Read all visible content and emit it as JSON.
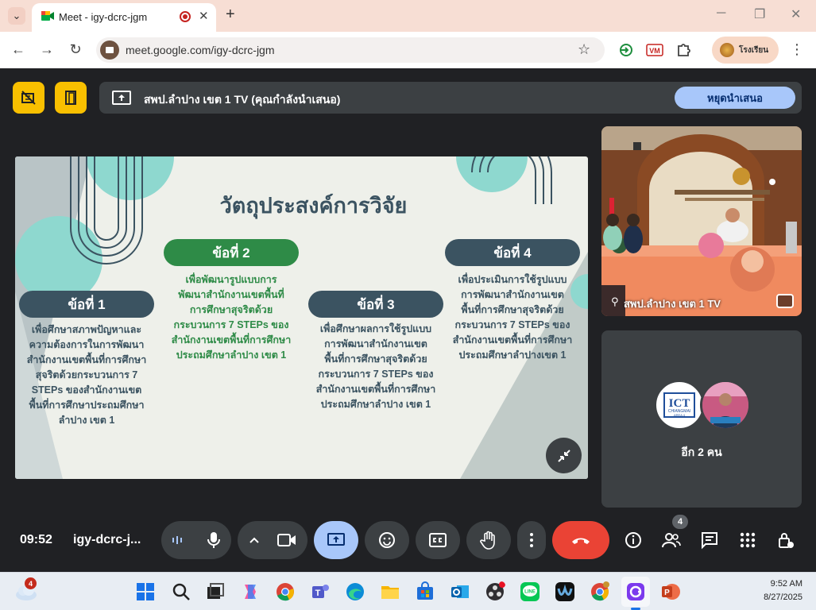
{
  "browser": {
    "tab_title": "Meet - igy-dcrc-jgm",
    "tab_close": "✕",
    "new_tab": "+",
    "url": "meet.google.com/igy-dcrc-jgm",
    "profile_name": "โรงเรียน",
    "back": "←",
    "forward": "→",
    "reload": "↻",
    "star": "☆",
    "menu": "⋮",
    "minimize": "─",
    "restore": "❐",
    "close": "✕",
    "tab_list": "⌄"
  },
  "meet": {
    "presenting_text": "สพป.ลำปาง เขต 1 TV (คุณกำลังนำเสนอ)",
    "stop_presenting": "หยุดนำเสนอ",
    "presenter_name": "สพป.ลำปาง เขต 1 TV",
    "others_text": "อีก 2 คน",
    "clock": "09:52",
    "meeting_code": "igy-dcrc-j...",
    "people_count": "4",
    "slide": {
      "title": "วัตถุประสงค์การวิจัย",
      "items": [
        {
          "label": "ข้อที่ 1",
          "lines": [
            "เพื่อศึกษาสภาพปัญหาและ",
            "ความต้องการในการพัฒนา",
            "สำนักงานเขตพื้นที่การศึกษา",
            "สุจริตด้วยกระบวนการ 7",
            "STEPs ของสำนักงานเขต",
            "พื้นที่การศึกษาประถมศึกษา",
            "ลำปาง เขต 1"
          ]
        },
        {
          "label": "ข้อที่ 2",
          "lines": [
            "เพื่อพัฒนารูปแบบการ",
            "พัฒนาสำนักงานเขตพื้นที่",
            "การศึกษาสุจริตด้วย",
            "กระบวนการ 7 STEPs ของ",
            "สำนักงานเขตพื้นที่การศึกษา",
            "ประถมศึกษาลำปาง เขต 1"
          ]
        },
        {
          "label": "ข้อที่ 3",
          "lines": [
            "เพื่อศึกษาผลการใช้รูปแบบ",
            "การพัฒนาสำนักงานเขต",
            "พื้นที่การศึกษาสุจริตด้วย",
            "กระบวนการ 7 STEPs ของ",
            "สำนักงานเขตพื้นที่การศึกษา",
            "ประถมศึกษาลำปาง เขต 1"
          ]
        },
        {
          "label": "ข้อที่ 4",
          "lines": [
            "เพื่อประเมินการใช้รูปแบบ",
            "การพัฒนาสำนักงานเขต",
            "พื้นที่การศึกษาสุจริตด้วย",
            "กระบวนการ 7 STEPs ของ",
            "สำนักงานเขตพื้นที่การศึกษา",
            "ประถมศึกษาลำปางเขต 1"
          ]
        }
      ]
    },
    "avatar_logo": {
      "line1": "ICT",
      "line2": "CHIANGMAI",
      "line3": "AREA 4"
    }
  },
  "taskbar": {
    "weather_badge": "4",
    "time": "9:52 AM",
    "date": "8/27/2025",
    "line_label": "LINE"
  },
  "colors": {
    "meet_bg": "#202124",
    "yellow": "#f9c000",
    "stop_btn": "#a8c7fa",
    "hangup": "#ea4335",
    "slide_navy": "#3b5361",
    "slide_green": "#2e8b47",
    "slide_teal": "#8ed8cf"
  }
}
